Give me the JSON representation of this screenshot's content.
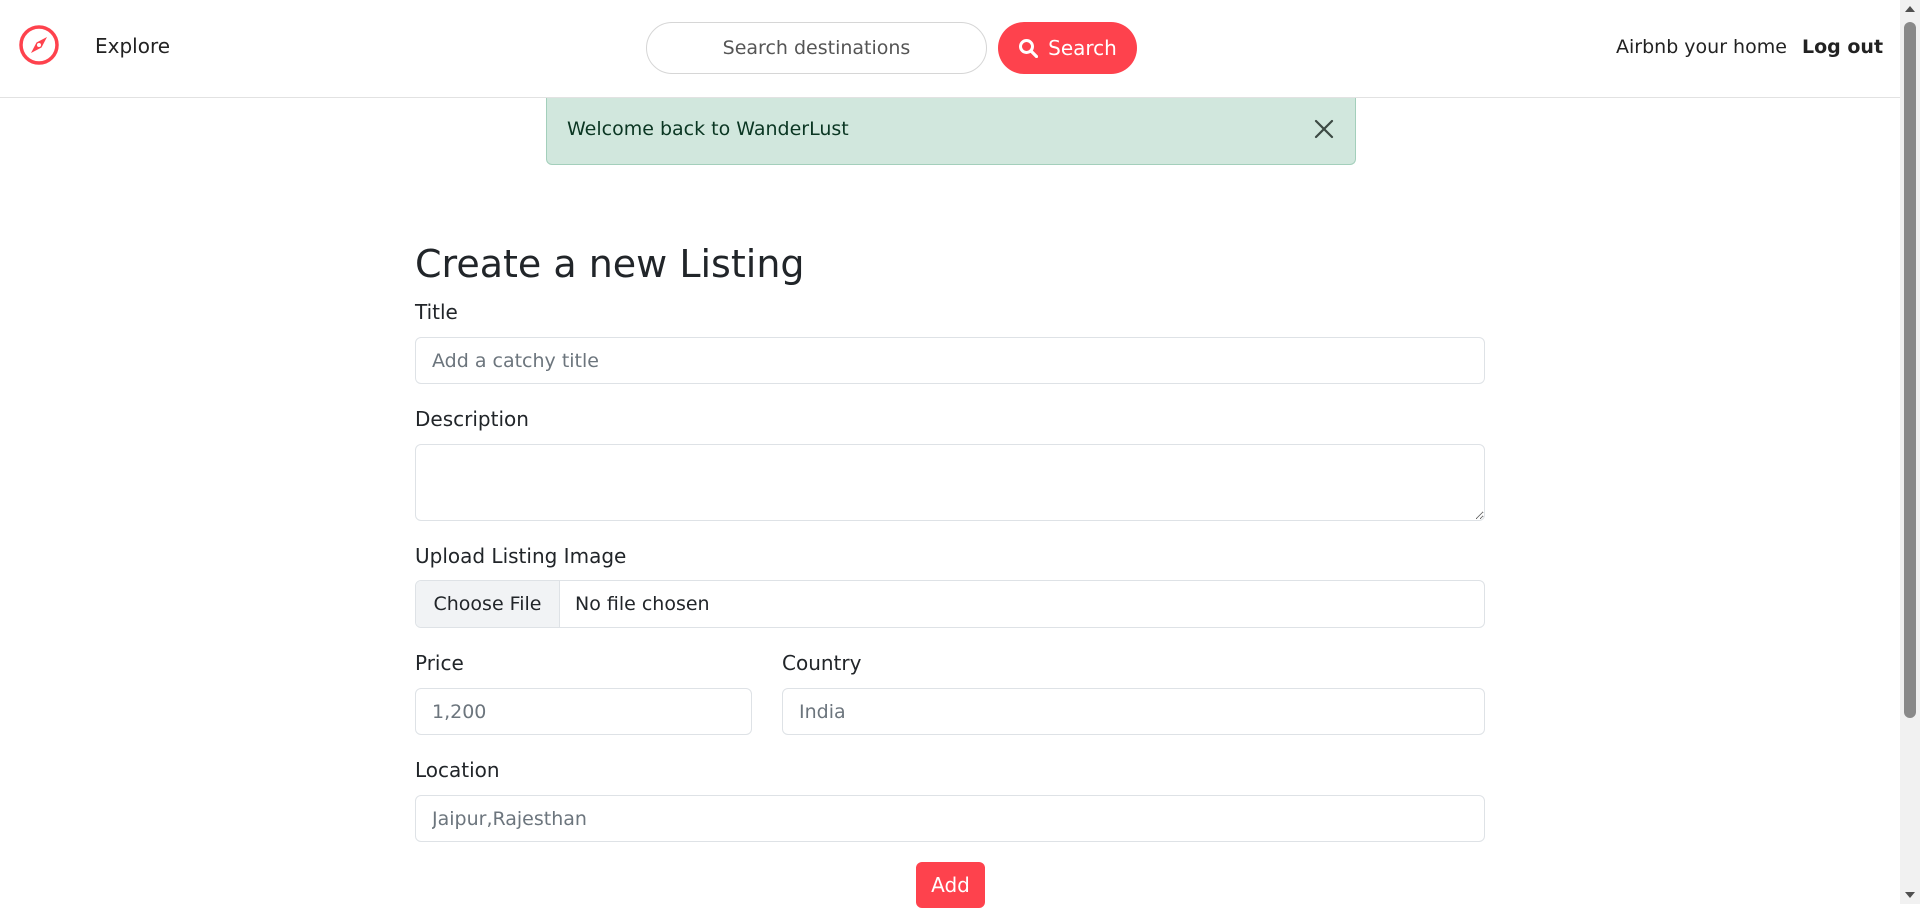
{
  "navbar": {
    "logo_icon": "compass-icon",
    "explore_label": "Explore",
    "search_placeholder": "Search destinations",
    "search_button_label": "Search",
    "host_label": "Airbnb your home",
    "logout_label": "Log out"
  },
  "alert": {
    "message": "Welcome back to WanderLust",
    "close_icon": "close-icon"
  },
  "form": {
    "title": "Create a new Listing",
    "fields": {
      "title": {
        "label": "Title",
        "placeholder": "Add a catchy title",
        "value": ""
      },
      "description": {
        "label": "Description",
        "value": ""
      },
      "image": {
        "label": "Upload Listing Image",
        "button_label": "Choose File",
        "status": "No file chosen"
      },
      "price": {
        "label": "Price",
        "placeholder": "1,200"
      },
      "country": {
        "label": "Country",
        "placeholder": "India"
      },
      "location": {
        "label": "Location",
        "placeholder": "Jaipur,Rajesthan"
      }
    },
    "submit_label": "Add"
  },
  "colors": {
    "brand": "#fe424d",
    "alert_bg": "#d1e7dd",
    "alert_text": "#0a3622"
  }
}
